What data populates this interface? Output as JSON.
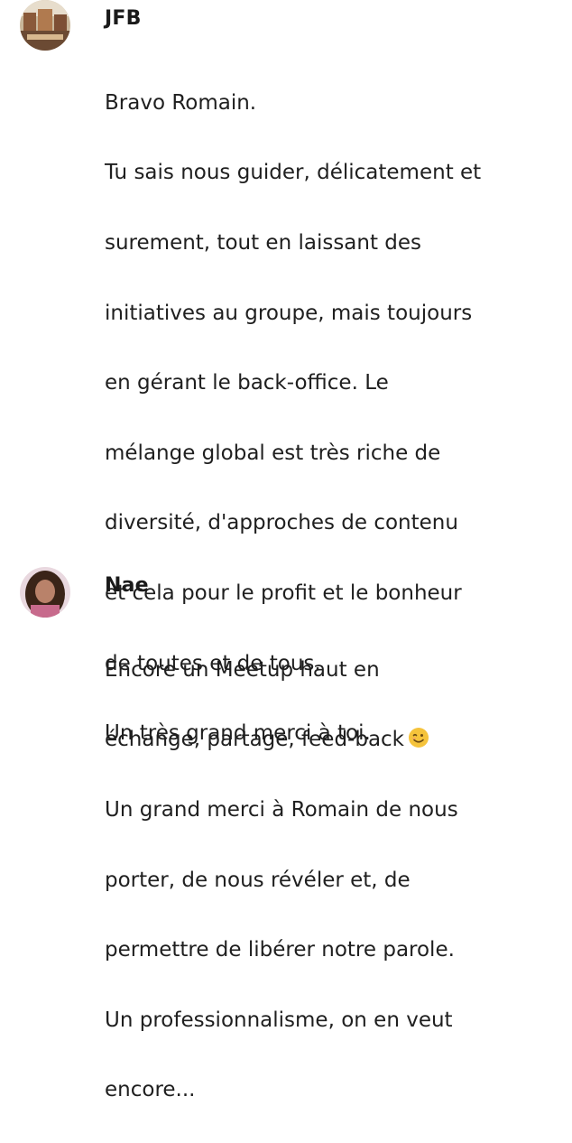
{
  "comments": [
    {
      "author": "JFB",
      "avatar_icon": "avatar-photo-icon",
      "lines": [
        "Bravo Romain.",
        "Tu sais nous guider, délicatement et",
        "surement, tout en laissant des",
        "initiatives au groupe, mais toujours",
        "en gérant le back-office. Le",
        "mélange global est très riche de",
        "diversité, d'approches de contenu",
        "et cela pour le profit et le bonheur",
        "de toutes et de tous.",
        "Un très grand merci à toi."
      ]
    },
    {
      "author": "Nae",
      "avatar_icon": "avatar-photo-icon",
      "lines": [
        "Encore un Meetup haut en",
        "échange, partage, feed-back",
        "Un grand merci à Romain de nous",
        "porter, de nous révéler et, de",
        "permettre de libérer notre parole.",
        "Un professionnalisme, on en veut",
        "encore..."
      ],
      "emoji": "winking-face-icon"
    }
  ],
  "colors": {
    "text": "#1f1f1f",
    "background": "#ffffff",
    "emoji_face": "#f5c33b"
  }
}
